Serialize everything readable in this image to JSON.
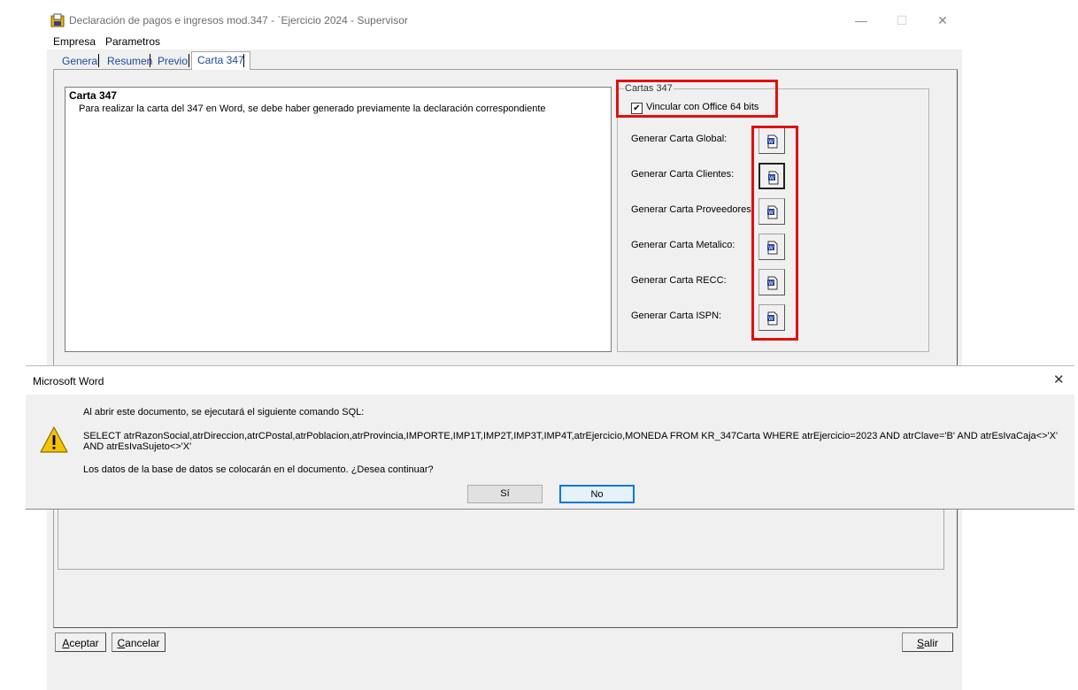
{
  "window": {
    "title": "Declaración de pagos e ingresos mod.347 - `Ejercicio 2024 - Supervisor",
    "minimize": "—",
    "maximize": "☐",
    "close": "✕"
  },
  "menu": {
    "items": [
      "Empresa",
      "Parametros"
    ]
  },
  "tabs": [
    {
      "label": "General"
    },
    {
      "label": "Resumen"
    },
    {
      "label": "Previo"
    },
    {
      "label": "Carta 347",
      "active": true
    }
  ],
  "info": {
    "title": "Carta 347",
    "text": "Para realizar la carta del 347 en Word, se debe haber generado previamente la declaración correspondiente"
  },
  "cartas": {
    "group_label": "Cartas 347",
    "checkbox_label": "Vincular con Office 64 bits",
    "checkbox_checked": true,
    "checkbox_mark": "✔",
    "buttons": [
      {
        "label": "Generar Carta Global:"
      },
      {
        "label": "Generar Carta Clientes:"
      },
      {
        "label": "Generar Carta Proveedores:"
      },
      {
        "label": "Generar Carta Metalico:"
      },
      {
        "label": "Generar Carta RECC:"
      },
      {
        "label": "Generar Carta ISPN:"
      }
    ]
  },
  "bottom_buttons": {
    "accept": {
      "mnemonic": "A",
      "rest": "ceptar"
    },
    "cancel": {
      "mnemonic": "C",
      "rest": "ancelar"
    },
    "exit": {
      "mnemonic": "S",
      "rest": "alir"
    }
  },
  "dialog": {
    "title": "Microsoft Word",
    "close": "✕",
    "message": "Al abrir este documento, se ejecutará el siguiente comando SQL:",
    "sql": "SELECT atrRazonSocial,atrDireccion,atrCPostal,atrPoblacion,atrProvincia,IMPORTE,IMP1T,IMP2T,IMP3T,IMP4T,atrEjercicio,MONEDA FROM KR_347Carta WHERE atrEjercicio=2023 AND atrClave='B' AND atrEsIvaCaja<>'X' AND atrEsIvaSujeto<>'X'",
    "question": "Los datos de la base de datos se colocarán en el documento. ¿Desea continuar?",
    "yes": "Sí",
    "no": "No",
    "warning_icon": "warning-icon"
  },
  "colors": {
    "highlight": "#e01010",
    "tab_text": "#1a4a9a",
    "focus_blue": "#0078d7",
    "warning_yellow": "#f5c400"
  }
}
